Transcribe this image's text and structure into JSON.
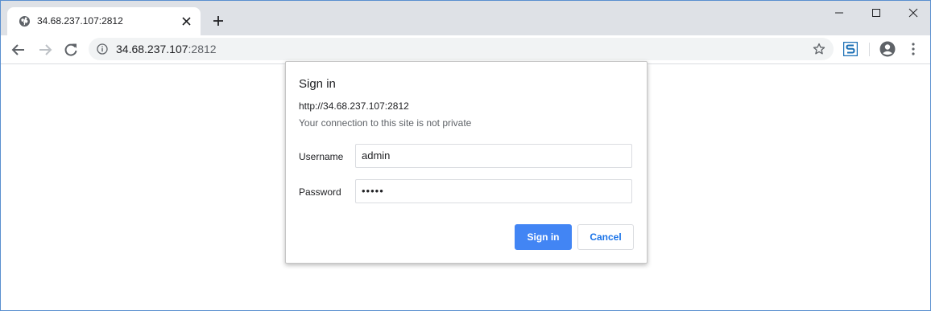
{
  "tab": {
    "title": "34.68.237.107:2812",
    "favicon": "globe-icon",
    "close_icon": "close-icon",
    "new_tab_icon": "plus-icon"
  },
  "window_controls": [
    "minimize-icon",
    "maximize-icon",
    "close-icon"
  ],
  "toolbar": {
    "back_icon": "arrow-left-icon",
    "forward_icon": "arrow-right-icon",
    "reload_icon": "reload-icon",
    "omnibox": {
      "info_icon": "info-icon",
      "host": "34.68.237.107",
      "port": ":2812",
      "star_icon": "star-icon"
    },
    "extension_icon": "extension-s-icon",
    "profile_icon": "account-circle-icon",
    "menu_icon": "more-vert-icon"
  },
  "dialog": {
    "title": "Sign in",
    "url": "http://34.68.237.107:2812",
    "warning": "Your connection to this site is not private",
    "username_label": "Username",
    "username_value": "admin",
    "password_label": "Password",
    "password_value": "•••••",
    "signin_label": "Sign in",
    "cancel_label": "Cancel"
  },
  "colors": {
    "tabstrip_bg": "#dee1e6",
    "omnibox_bg": "#f1f3f4",
    "primary_button": "#4285f4",
    "link_blue": "#1a73e8",
    "window_border": "#5a8fcf"
  }
}
